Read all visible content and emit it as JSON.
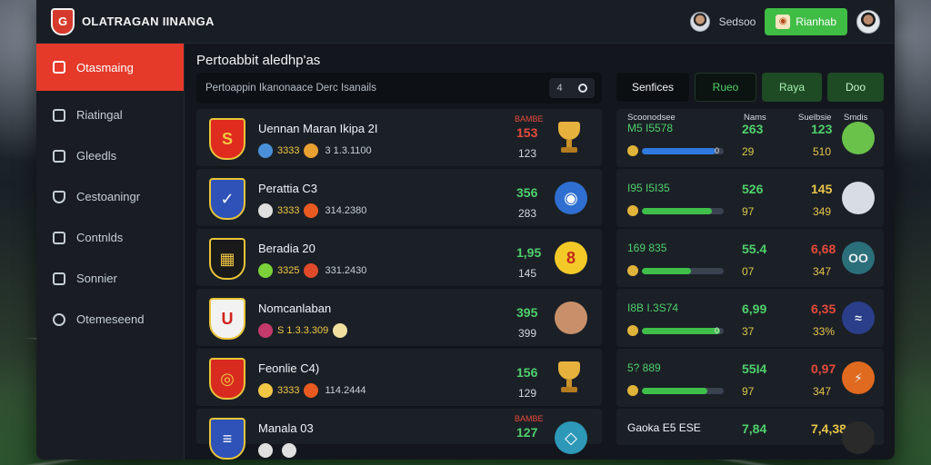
{
  "app": {
    "title": "OLATRAGAN IINANGA",
    "logo_letter": "G",
    "user_name": "Sedsoo",
    "cta_label": "Rianhab"
  },
  "sidebar": {
    "items": [
      {
        "label": "Otasmaing",
        "icon": "dashboard-icon",
        "active": true
      },
      {
        "label": "Riatingal",
        "icon": "building-icon"
      },
      {
        "label": "Gleedls",
        "icon": "home-icon"
      },
      {
        "label": "Cestoaningr",
        "icon": "shield-icon"
      },
      {
        "label": "Contnlds",
        "icon": "upload-icon"
      },
      {
        "label": "Sonnier",
        "icon": "briefcase-icon"
      },
      {
        "label": "Otemeseend",
        "icon": "search-icon"
      }
    ]
  },
  "main": {
    "section_title": "Pertoabbit aledhp'as",
    "filter_text": "Pertoappin Ikanonaace Derc Isanails",
    "filter_ctrl": "4",
    "tabs": [
      "Senfices",
      "Rueo",
      "Raya",
      "Doo"
    ]
  },
  "teams": [
    {
      "name": "Uennan Maran Ikipa 2I",
      "meta_a": "3333",
      "meta_b": "3 1.3.1100",
      "label": "BAMBE",
      "stat_top": "153",
      "stat_bot": "123",
      "badge_letter": "S",
      "badge_bg": "#e02b1f",
      "badge_color": "#f2c744",
      "coin_a": "#4a90d9",
      "coin_b": "#e8a030",
      "stat_color": "#e54a3a",
      "icon": "trophy-icon"
    },
    {
      "name": "Perattia C3",
      "meta_a": "3333",
      "meta_b": "314.2380",
      "label": "",
      "stat_top": "356",
      "stat_bot": "283",
      "badge_letter": "✓",
      "badge_bg": "#2f52b8",
      "badge_color": "#ffffff",
      "coin_a": "#e0e0e0",
      "coin_b": "#e85a20",
      "stat_color": "#4fd06b",
      "icon": "club-badge-icon",
      "icon_bg": "#2f6fd1",
      "icon_text": "◉"
    },
    {
      "name": "Beradia 20",
      "meta_a": "3325",
      "meta_b": "331.2430",
      "label": "",
      "stat_top": "1,95",
      "stat_bot": "145",
      "badge_letter": "▦",
      "badge_bg": "#1a1a1a",
      "badge_color": "#f2c744",
      "coin_a": "#7ad13a",
      "coin_b": "#e04a2a",
      "stat_color": "#4fd06b",
      "icon": "number-badge-icon",
      "icon_bg": "#f3c928",
      "icon_text": "8",
      "icon_text_color": "#c42a1a"
    },
    {
      "name": "Nomcanlaban",
      "meta_a": "S 1.3.3.309",
      "meta_b": "",
      "label": "",
      "stat_top": "395",
      "stat_bot": "399",
      "badge_letter": "U",
      "badge_bg": "#f2f2f2",
      "badge_color": "#d0201a",
      "coin_a": "#c43a6a",
      "coin_b": "#f0e0a0",
      "stat_color": "#4fd06b",
      "icon": "player-avatar-icon",
      "icon_bg": "#c8906a",
      "icon_text": ""
    },
    {
      "name": "Feonlie C4)",
      "meta_a": "3333",
      "meta_b": "114.2444",
      "label": "",
      "stat_top": "156",
      "stat_bot": "129",
      "badge_letter": "◎",
      "badge_bg": "#d82a1f",
      "badge_color": "#f2c744",
      "coin_a": "#f2c744",
      "coin_b": "#e85a20",
      "stat_color": "#4fd06b",
      "icon": "trophy-icon"
    },
    {
      "name": "Manala 03",
      "meta_a": "",
      "meta_b": "",
      "label": "BAMBE",
      "stat_top": "127",
      "stat_bot": "",
      "badge_letter": "≡",
      "badge_bg": "#2f52b8",
      "badge_color": "#ffffff",
      "coin_a": "#e0e0e0",
      "coin_b": "#e0e0e0",
      "stat_color": "#4fd06b",
      "icon": "club-badge-icon",
      "icon_bg": "#2e98b8",
      "icon_text": "◇"
    }
  ],
  "right_panel": {
    "headers": {
      "col1": "Scoonodsee",
      "col2": "Nams",
      "col3": "Suelbsie",
      "col4": "Smdis"
    },
    "rows": [
      {
        "title": "M5 I5578",
        "progress_pct": 90,
        "progress_label": "0",
        "fill": "#2f7ae0",
        "a": "263",
        "a2": "29",
        "b": "123",
        "b2": "510",
        "b_color": "#4fd06b",
        "avatar_bg": "#6ac24a",
        "avatar_text": ""
      },
      {
        "title": "I95 I5I35",
        "progress_pct": 85,
        "progress_label": "",
        "fill": "#3fbf4a",
        "a": "526",
        "a2": "97",
        "b": "145",
        "b2": "349",
        "b_color": "#e7c44a",
        "avatar_bg": "#d8dde3",
        "avatar_text": ""
      },
      {
        "title": "169 835",
        "progress_pct": 60,
        "progress_label": "",
        "fill": "#3fbf4a",
        "a": "55.4",
        "a2": "07",
        "b": "6,68",
        "b2": "347",
        "b_color": "#e54a3a",
        "avatar_bg": "#2a6f7a",
        "avatar_text": "OO"
      },
      {
        "title": "I8B I.3S74",
        "progress_pct": 95,
        "progress_label": "0",
        "fill": "#3fbf4a",
        "a": "6,99",
        "a2": "37",
        "b": "6,35",
        "b2": "33%",
        "b_color": "#e54a3a",
        "avatar_bg": "#2a3e8a",
        "avatar_text": "≈"
      },
      {
        "title": "5? 889",
        "progress_pct": 80,
        "progress_label": "",
        "fill": "#3fbf4a",
        "a": "55I4",
        "a2": "97",
        "b": "0,97",
        "b2": "347",
        "b_color": "#e54a3a",
        "avatar_bg": "#e06a20",
        "avatar_text": "⚡"
      },
      {
        "title": "Gaoka E5 ESE",
        "progress_pct": 0,
        "progress_label": "",
        "fill": "#3fbf4a",
        "a": "7,84",
        "a2": "",
        "b": "7,4,38",
        "b2": "",
        "b_color": "#e7c44a",
        "avatar_bg": "#2a2a2a",
        "avatar_text": ""
      }
    ]
  },
  "colors": {
    "accent": "#e53a2a",
    "positive": "#4fd06b",
    "cta": "#3fbd45"
  }
}
